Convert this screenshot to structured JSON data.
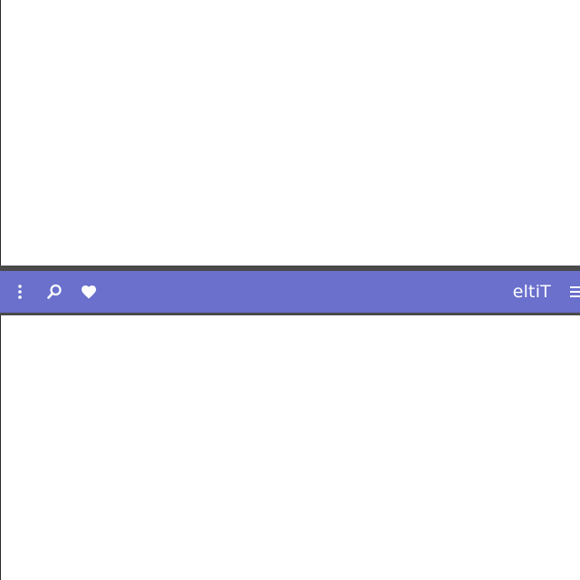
{
  "app_bar": {
    "title": "Title",
    "background_color": "#6a70cc",
    "border_color": "#4a4a4a",
    "icon_color": "#ffffff",
    "actions": [
      {
        "name": "more-vert-icon"
      },
      {
        "name": "search-icon"
      },
      {
        "name": "heart-icon"
      }
    ],
    "navigation_icon": "menu-icon"
  }
}
